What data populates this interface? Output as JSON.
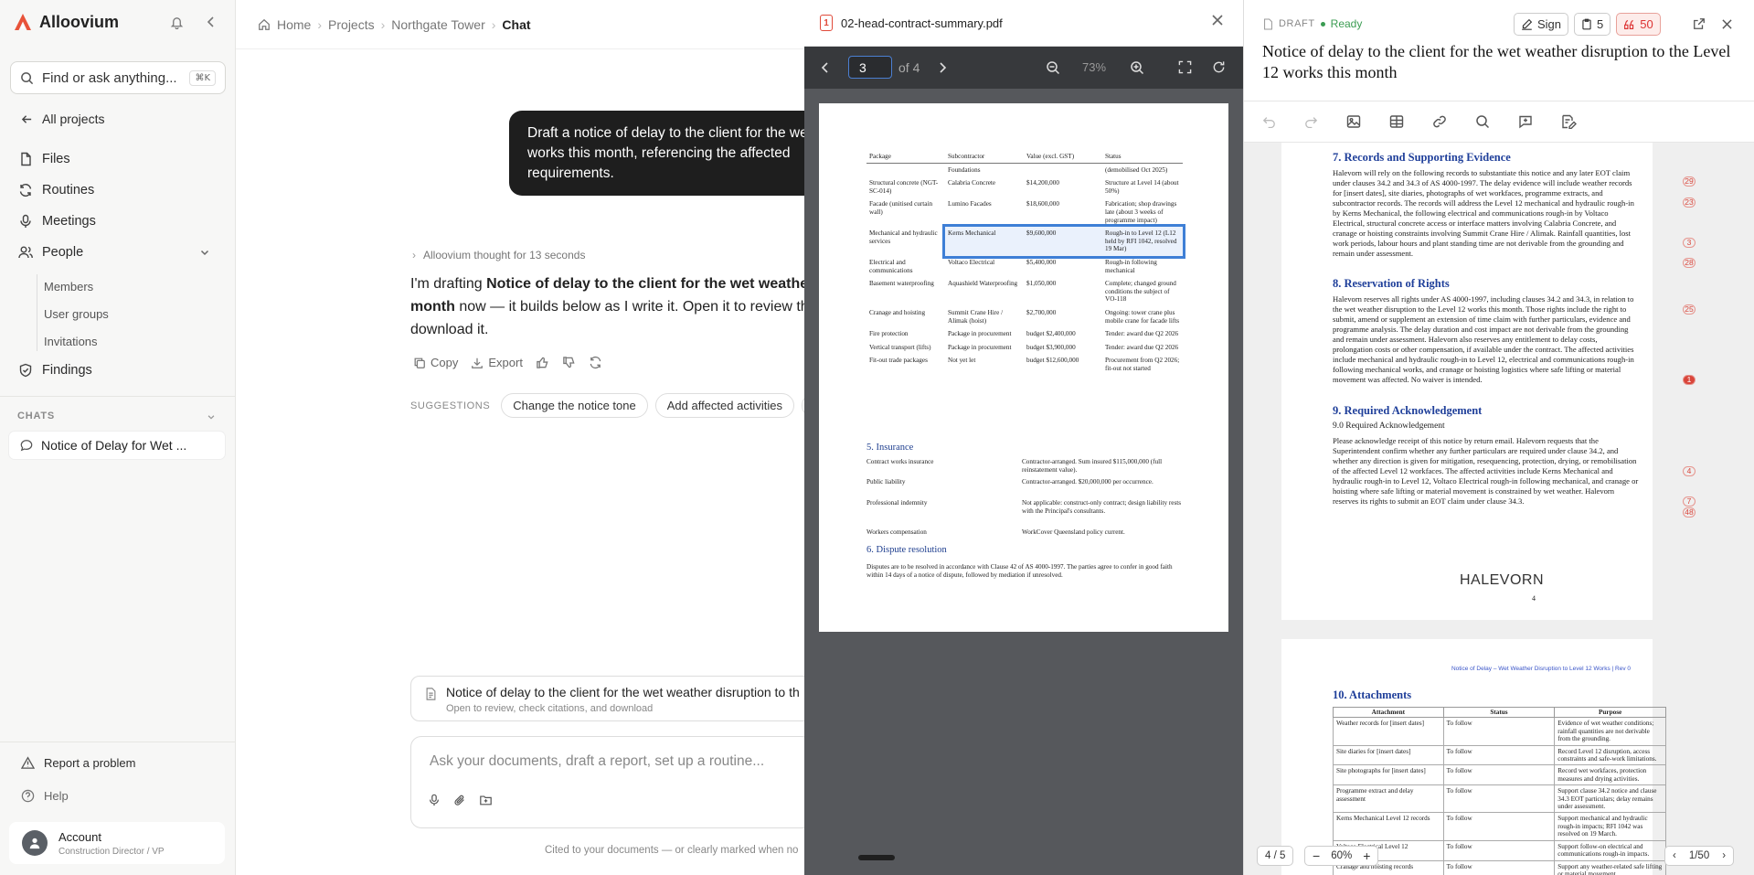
{
  "brand": {
    "name": "Alloovium"
  },
  "sidebar": {
    "search_placeholder": "Find or ask anything...",
    "search_shortcut": "⌘K",
    "back": "All projects",
    "items": {
      "files": "Files",
      "routines": "Routines",
      "meetings": "Meetings",
      "people": "People",
      "findings": "Findings"
    },
    "people_sub": [
      "Members",
      "User groups",
      "Invitations"
    ],
    "chats_label": "CHATS",
    "chat_item": "Notice of Delay for Wet ...",
    "report": "Report a problem",
    "help": "Help",
    "account_name": "Account",
    "account_role": "Construction Director / VP"
  },
  "breadcrumb": [
    "Home",
    "Projects",
    "Northgate Tower",
    "Chat"
  ],
  "chat": {
    "user_lines": [
      "Draft a notice of delay to the client for the wet",
      "works this month, referencing the affected",
      "requirements."
    ],
    "thought": "Alloovium thought for 13 seconds",
    "resp_pre": "I'm drafting ",
    "resp_bold1": "Notice of delay to the client for the wet weather",
    "resp_bold2": "month",
    "resp_mid": " now — it builds below as I write it. Open it to review th",
    "resp_end": "download it.",
    "actions": {
      "copy": "Copy",
      "export": "Export"
    },
    "suggestions_label": "SUGGESTIONS",
    "suggestions": [
      "Change the notice tone",
      "Add affected activities",
      "A"
    ],
    "doc_card_title": "Notice of delay to the client for the wet weather disruption to th",
    "doc_card_sub": "Open to review, check citations, and download",
    "composer_placeholder": "Ask your documents, draft a report, set up a routine...",
    "footnote": "Cited to your documents — or clearly marked when no"
  },
  "pdf": {
    "badge": "1",
    "filename": "02-head-contract-summary.pdf",
    "page": "3",
    "of": "of 4",
    "zoom": "73%",
    "table_headers": [
      "Package",
      "Subcontractor",
      "Value (excl. GST)",
      "Status"
    ],
    "rows": [
      [
        "",
        "Foundations",
        "",
        "(demobilised Oct 2025)"
      ],
      [
        "Structural concrete (NGT-SC-014)",
        "Calabria Concrete",
        "$14,200,000",
        "Structure at Level 14 (about 50%)"
      ],
      [
        "Facade (unitised curtain wall)",
        "Lumino Facades",
        "$18,600,000",
        "Fabrication; shop drawings late (about 3 weeks of programme impact)"
      ],
      [
        "Mechanical and hydraulic services",
        "Kerns Mechanical",
        "$9,600,000",
        "Rough-in to Level 12 (L12 held by RFI 1042, resolved 19 Mar)"
      ],
      [
        "Electrical and communications",
        "Voltaco Electrical",
        "$5,400,000",
        "Rough-in following mechanical"
      ],
      [
        "Basement waterproofing",
        "Aquashield Waterproofing",
        "$1,050,000",
        "Complete; changed ground conditions the subject of VO-118"
      ],
      [
        "Cranage and hoisting",
        "Summit Crane Hire / Alimak (hoist)",
        "$2,700,000",
        "Ongoing: tower crane plus mobile crane for facade lifts"
      ],
      [
        "Fire protection",
        "Package in procurement",
        "budget $2,400,000",
        "Tender: award due Q2 2026"
      ],
      [
        "Vertical transport (lifts)",
        "Package in procurement",
        "budget $3,900,000",
        "Tender: award due Q2 2026"
      ],
      [
        "Fit-out trade packages",
        "Not yet let",
        "budget $12,600,000",
        "Procurement from Q2 2026; fit-out not started"
      ]
    ],
    "insurance_head": "5. Insurance",
    "insurance": [
      [
        "Contract works insurance",
        "Contractor-arranged. Sum insured $115,000,000 (full reinstatement value)."
      ],
      [
        "Public liability",
        "Contractor-arranged. $20,000,000 per occurrence."
      ],
      [
        "Professional indemnity",
        "Not applicable: construct-only contract; design liability rests with the Principal's consultants."
      ],
      [
        "Workers compensation",
        "WorkCover Queensland policy current."
      ]
    ],
    "dispute_head": "6. Dispute resolution",
    "dispute_text": "Disputes are to be resolved in accordance with Clause 42 of AS 4000-1997. The parties agree to confer in good faith within 14 days of a notice of dispute, followed by mediation if unresolved."
  },
  "draft": {
    "label": "DRAFT",
    "status": "Ready",
    "sign": "Sign",
    "count": "5",
    "flags": "50",
    "title": "Notice of delay to the client for the wet weather disruption to the Level 12 works this month",
    "s7_head": "7. Records and Supporting Evidence",
    "s7_text": "Halevorn will rely on the following records to substantiate this notice and any later EOT claim under clauses 34.2 and 34.3 of AS 4000-1997. The delay evidence will include weather records for [insert dates], site diaries, photographs of wet workfaces, programme extracts, and subcontractor records. The records will address the Level 12 mechanical and hydraulic rough-in by Kerns Mechanical, the following electrical and communications rough-in by Voltaco Electrical, structural concrete access or interface matters involving Calabria Concrete, and cranage or hoisting constraints involving Summit Crane Hire / Alimak. Rainfall quantities, lost work periods, labour hours and plant standing time are not derivable from the grounding and remain under assessment.",
    "s8_head": "8. Reservation of Rights",
    "s8_text": "Halevorn reserves all rights under AS 4000-1997, including clauses 34.2 and 34.3, in relation to the wet weather disruption to the Level 12 works this month. Those rights include the right to submit, amend or supplement an extension of time claim with further particulars, evidence and programme analysis. The delay duration and cost impact are not derivable from the grounding and remain under assessment. Halevorn also reserves any entitlement to delay costs, prolongation costs or other compensation, if available under the contract. The affected activities include mechanical and hydraulic rough-in to Level 12, electrical and communications rough-in following mechanical works, and cranage or hoisting logistics where safe lifting or material movement was affected. No waiver is intended.",
    "s9_head": "9. Required Acknowledgement",
    "s9_sub": "9.0 Required Acknowledgement",
    "s9_text": "Please acknowledge receipt of this notice by return email. Halevorn requests that the Superintendent confirm whether any further particulars are required under clause 34.2, and whether any direction is given for mitigation, resequencing, protection, drying, or remobilisation of the affected Level 12 workfaces. The affected activities include Kerns Mechanical and hydraulic rough-in to Level 12, Voltaco Electrical rough-in following mechanical, and cranage or hoisting where safe lifting or material movement is constrained by wet weather. Halevorn reserves its rights to submit an EOT claim under clause 34.3.",
    "cites": [
      "29",
      "23",
      "3",
      "28",
      "25",
      "1",
      "4",
      "7",
      "48"
    ],
    "brand_mark": "HALEVORN",
    "page_no": "4",
    "header_line": "Notice of Delay – Wet Weather Disruption to Level 12 Works  |  Rev 0",
    "s10_head": "10. Attachments",
    "att_headers": [
      "Attachment",
      "Status",
      "Purpose"
    ],
    "attachments": [
      [
        "Weather records for [insert dates]",
        "To follow",
        "Evidence of wet weather conditions; rainfall quantities are not derivable from the grounding."
      ],
      [
        "Site diaries for [insert dates]",
        "To follow",
        "Record Level 12 disruption, access constraints and safe-work limitations."
      ],
      [
        "Site photographs for [insert dates]",
        "To follow",
        "Record wet workfaces, protection measures and drying activities."
      ],
      [
        "Programme extract and delay assessment",
        "To follow",
        "Support clause 34.2 notice and clause 34.3 EOT particulars; delay remains under assessment."
      ],
      [
        "Kerns Mechanical Level 12 records",
        "To follow",
        "Support mechanical and hydraulic rough-in impacts; RFI 1042 was resolved on 19 March."
      ],
      [
        "Voltaco Electrical Level 12",
        "To follow",
        "Support follow-on electrical and communications rough-in impacts."
      ],
      [
        "Cranage and hoisting records",
        "To follow",
        "Support any weather-related safe lifting or material movement"
      ]
    ],
    "page_indicator": "4 / 5",
    "zoom": "60%",
    "cite_nav": "1/50"
  }
}
